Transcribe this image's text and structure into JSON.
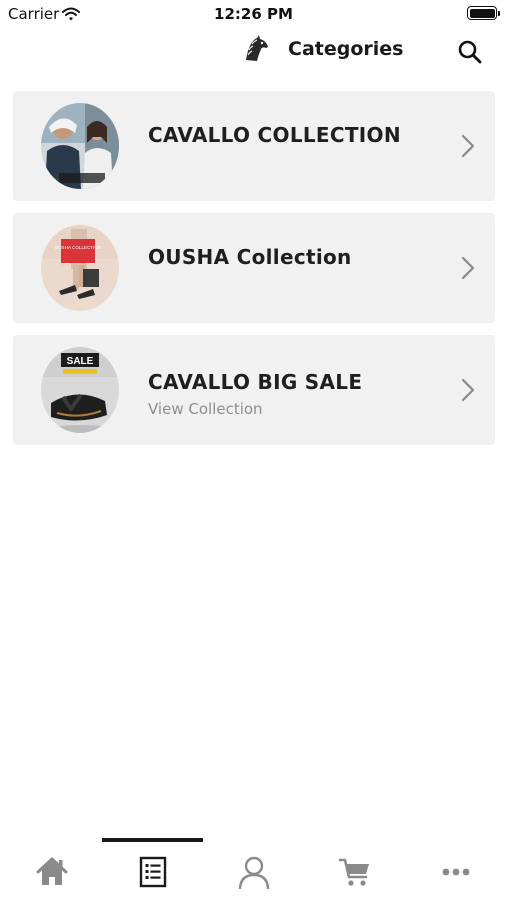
{
  "status_bar": {
    "carrier": "Carrier",
    "time": "12:26 PM"
  },
  "header": {
    "title": "Categories",
    "logo_icon": "horse-head-logo",
    "search_icon": "search-icon"
  },
  "categories": [
    {
      "title": "CAVALLO COLLECTION",
      "subtitle": ""
    },
    {
      "title": "OUSHA Collection",
      "subtitle": ""
    },
    {
      "title": "CAVALLO BIG SALE",
      "subtitle": "View Collection"
    }
  ],
  "thumbnail_lettering": {
    "ousha_sign": "OUSHA COLLECTION",
    "sale_sign": "SALE"
  },
  "tab_bar": {
    "tabs": [
      {
        "icon": "home-icon",
        "selected": false
      },
      {
        "icon": "categories-list-icon",
        "selected": true
      },
      {
        "icon": "profile-icon",
        "selected": false
      },
      {
        "icon": "cart-icon",
        "selected": false
      },
      {
        "icon": "more-icon",
        "selected": false
      }
    ]
  },
  "colors": {
    "card_background": "#f1f1f1",
    "subtitle": "#8e8e8e",
    "chevron": "#8a8a8a",
    "tab_icon_inactive": "#8a8a8a",
    "tab_icon_active": "#1b1b1b"
  }
}
